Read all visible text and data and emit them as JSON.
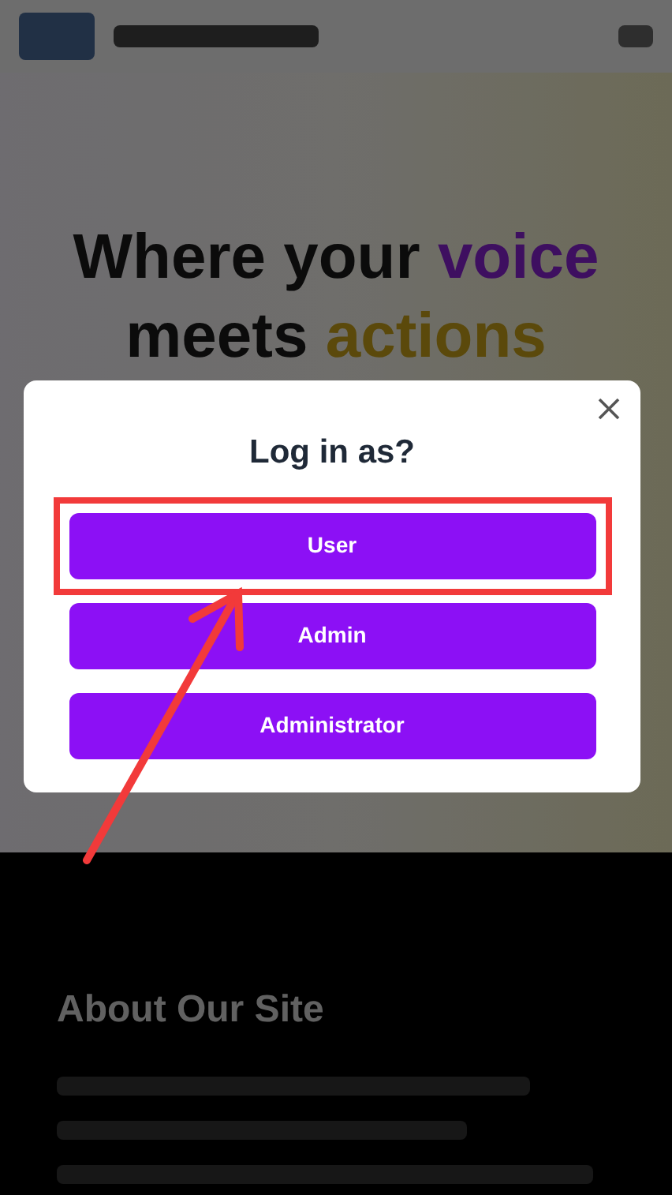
{
  "hero": {
    "headline": [
      {
        "text": "Where your",
        "kind": "plain"
      },
      {
        "text": "voice",
        "kind": "purple"
      },
      {
        "text": "meets",
        "kind": "plain"
      },
      {
        "text": "actions",
        "kind": "gold"
      }
    ]
  },
  "about": {
    "heading": "About Our Site"
  },
  "dialog": {
    "title": "Log in as?",
    "options": [
      {
        "label": "User",
        "highlighted": true
      },
      {
        "label": "Admin",
        "highlighted": false
      },
      {
        "label": "Administrator",
        "highlighted": false
      }
    ]
  }
}
